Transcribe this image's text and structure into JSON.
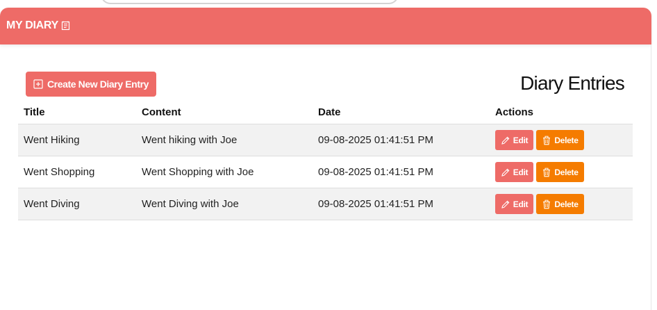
{
  "navbar": {
    "brand": "MY DIARY",
    "brand_icon": "journal-icon",
    "color": "#ee6b67"
  },
  "toolbar": {
    "create_label": "Create New Diary Entry",
    "create_icon": "plus-square-icon"
  },
  "heading": "Diary Entries",
  "table": {
    "columns": [
      "Title",
      "Content",
      "Date",
      "Actions"
    ],
    "rows": [
      {
        "title": "Went Hiking",
        "content": "Went hiking with Joe",
        "date": "09-08-2025 01:41:51 PM",
        "edit_label": "Edit",
        "delete_label": "Delete"
      },
      {
        "title": "Went Shopping",
        "content": "Went Shopping with Joe",
        "date": "09-08-2025 01:41:51 PM",
        "edit_label": "Edit",
        "delete_label": "Delete"
      },
      {
        "title": "Went Diving",
        "content": "Went Diving with Joe",
        "date": "09-08-2025 01:41:51 PM",
        "edit_label": "Edit",
        "delete_label": "Delete"
      }
    ]
  },
  "icons": {
    "edit": "pencil-icon",
    "delete": "trash-icon"
  },
  "colors": {
    "accent": "#ee6b67",
    "delete": "#f57c00",
    "stripe": "#f2f2f2"
  }
}
